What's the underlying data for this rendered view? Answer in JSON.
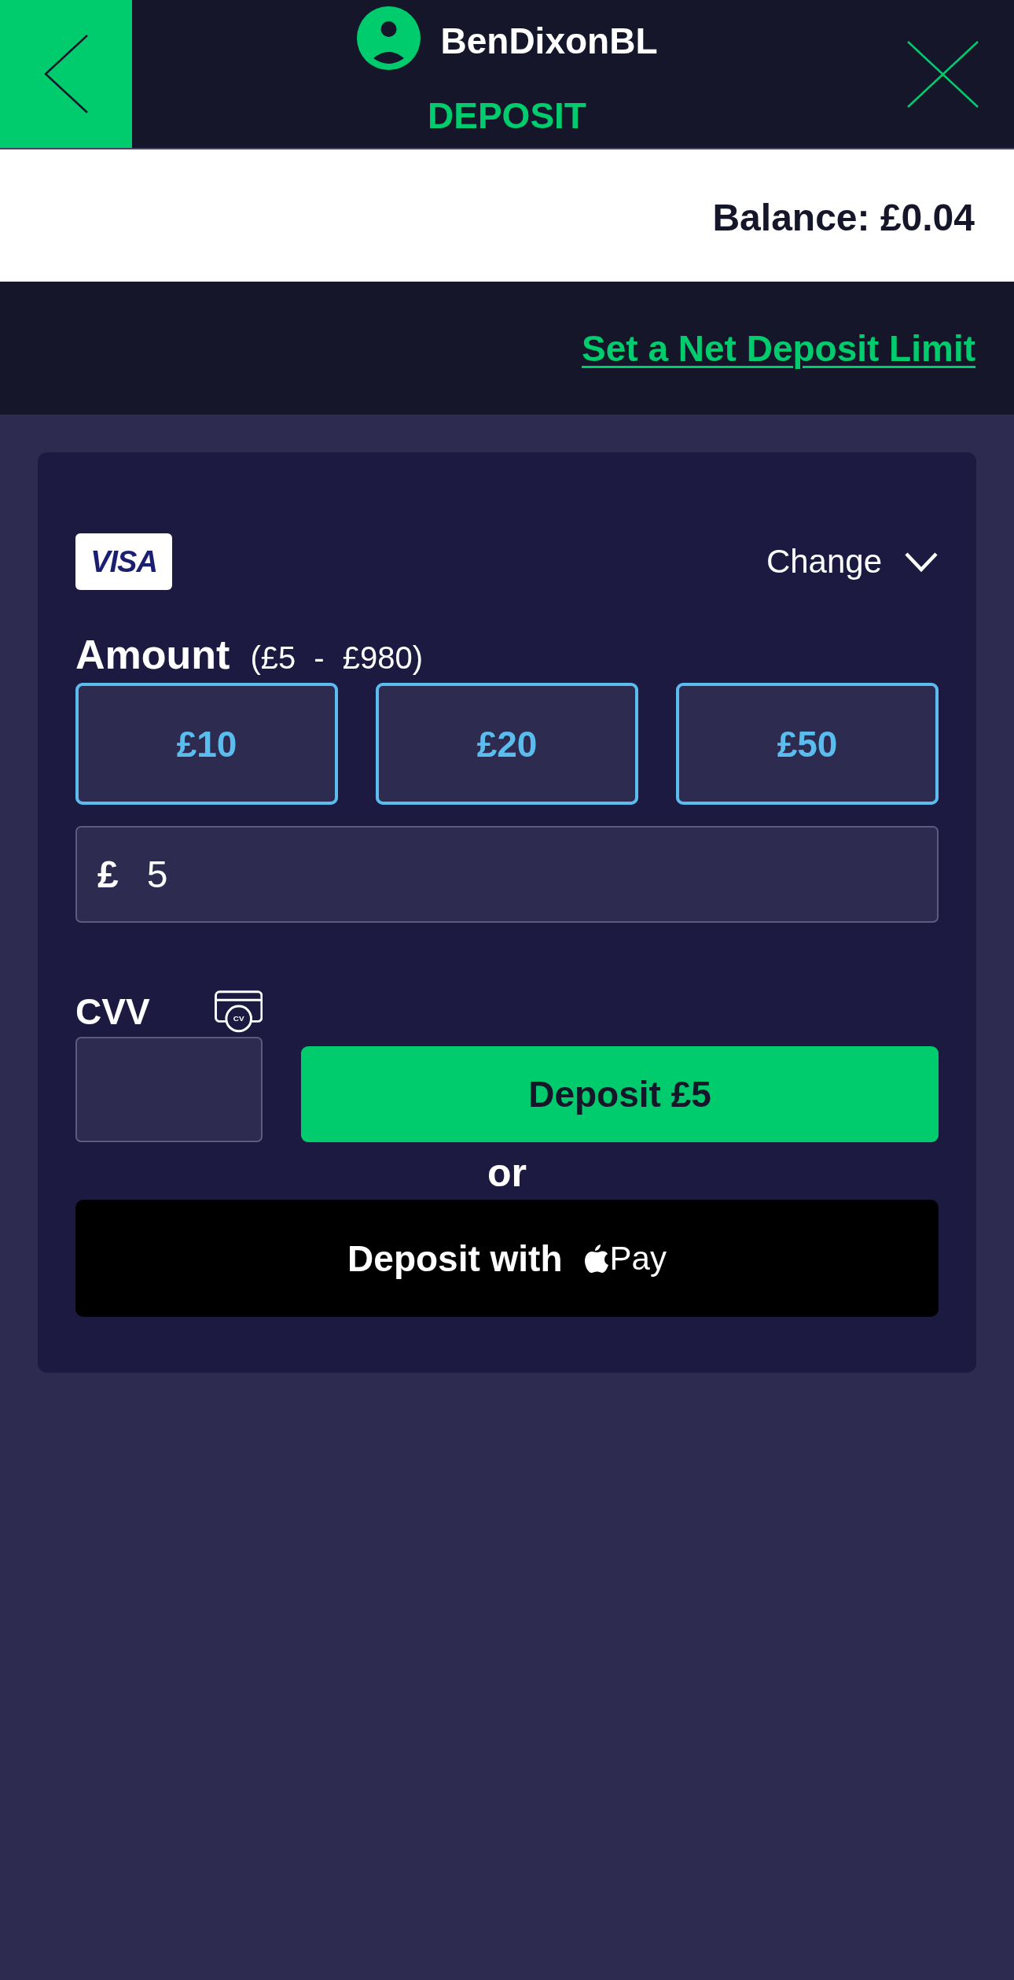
{
  "header": {
    "username": "BenDixonBL",
    "title": "DEPOSIT"
  },
  "balance": "Balance: £0.04",
  "limit_link": "Set a Net Deposit Limit",
  "deposit_card": {
    "payment_method": {
      "brand": "VISA",
      "change_label": "Change"
    },
    "amount": {
      "label": "Amount",
      "range": "(£5 - £980)",
      "presets": [
        {
          "label": "£10",
          "selected": false
        },
        {
          "label": "£20",
          "selected": false
        },
        {
          "label": "£50",
          "selected": false
        }
      ],
      "currency": "£",
      "value": "5"
    },
    "cvv": {
      "label": "CVV",
      "icon_label": "CV"
    },
    "deposit_button": "Deposit £5",
    "separator": "or",
    "apple_pay_button": {
      "label": "Deposit with",
      "brand_text": "Pay"
    }
  }
}
